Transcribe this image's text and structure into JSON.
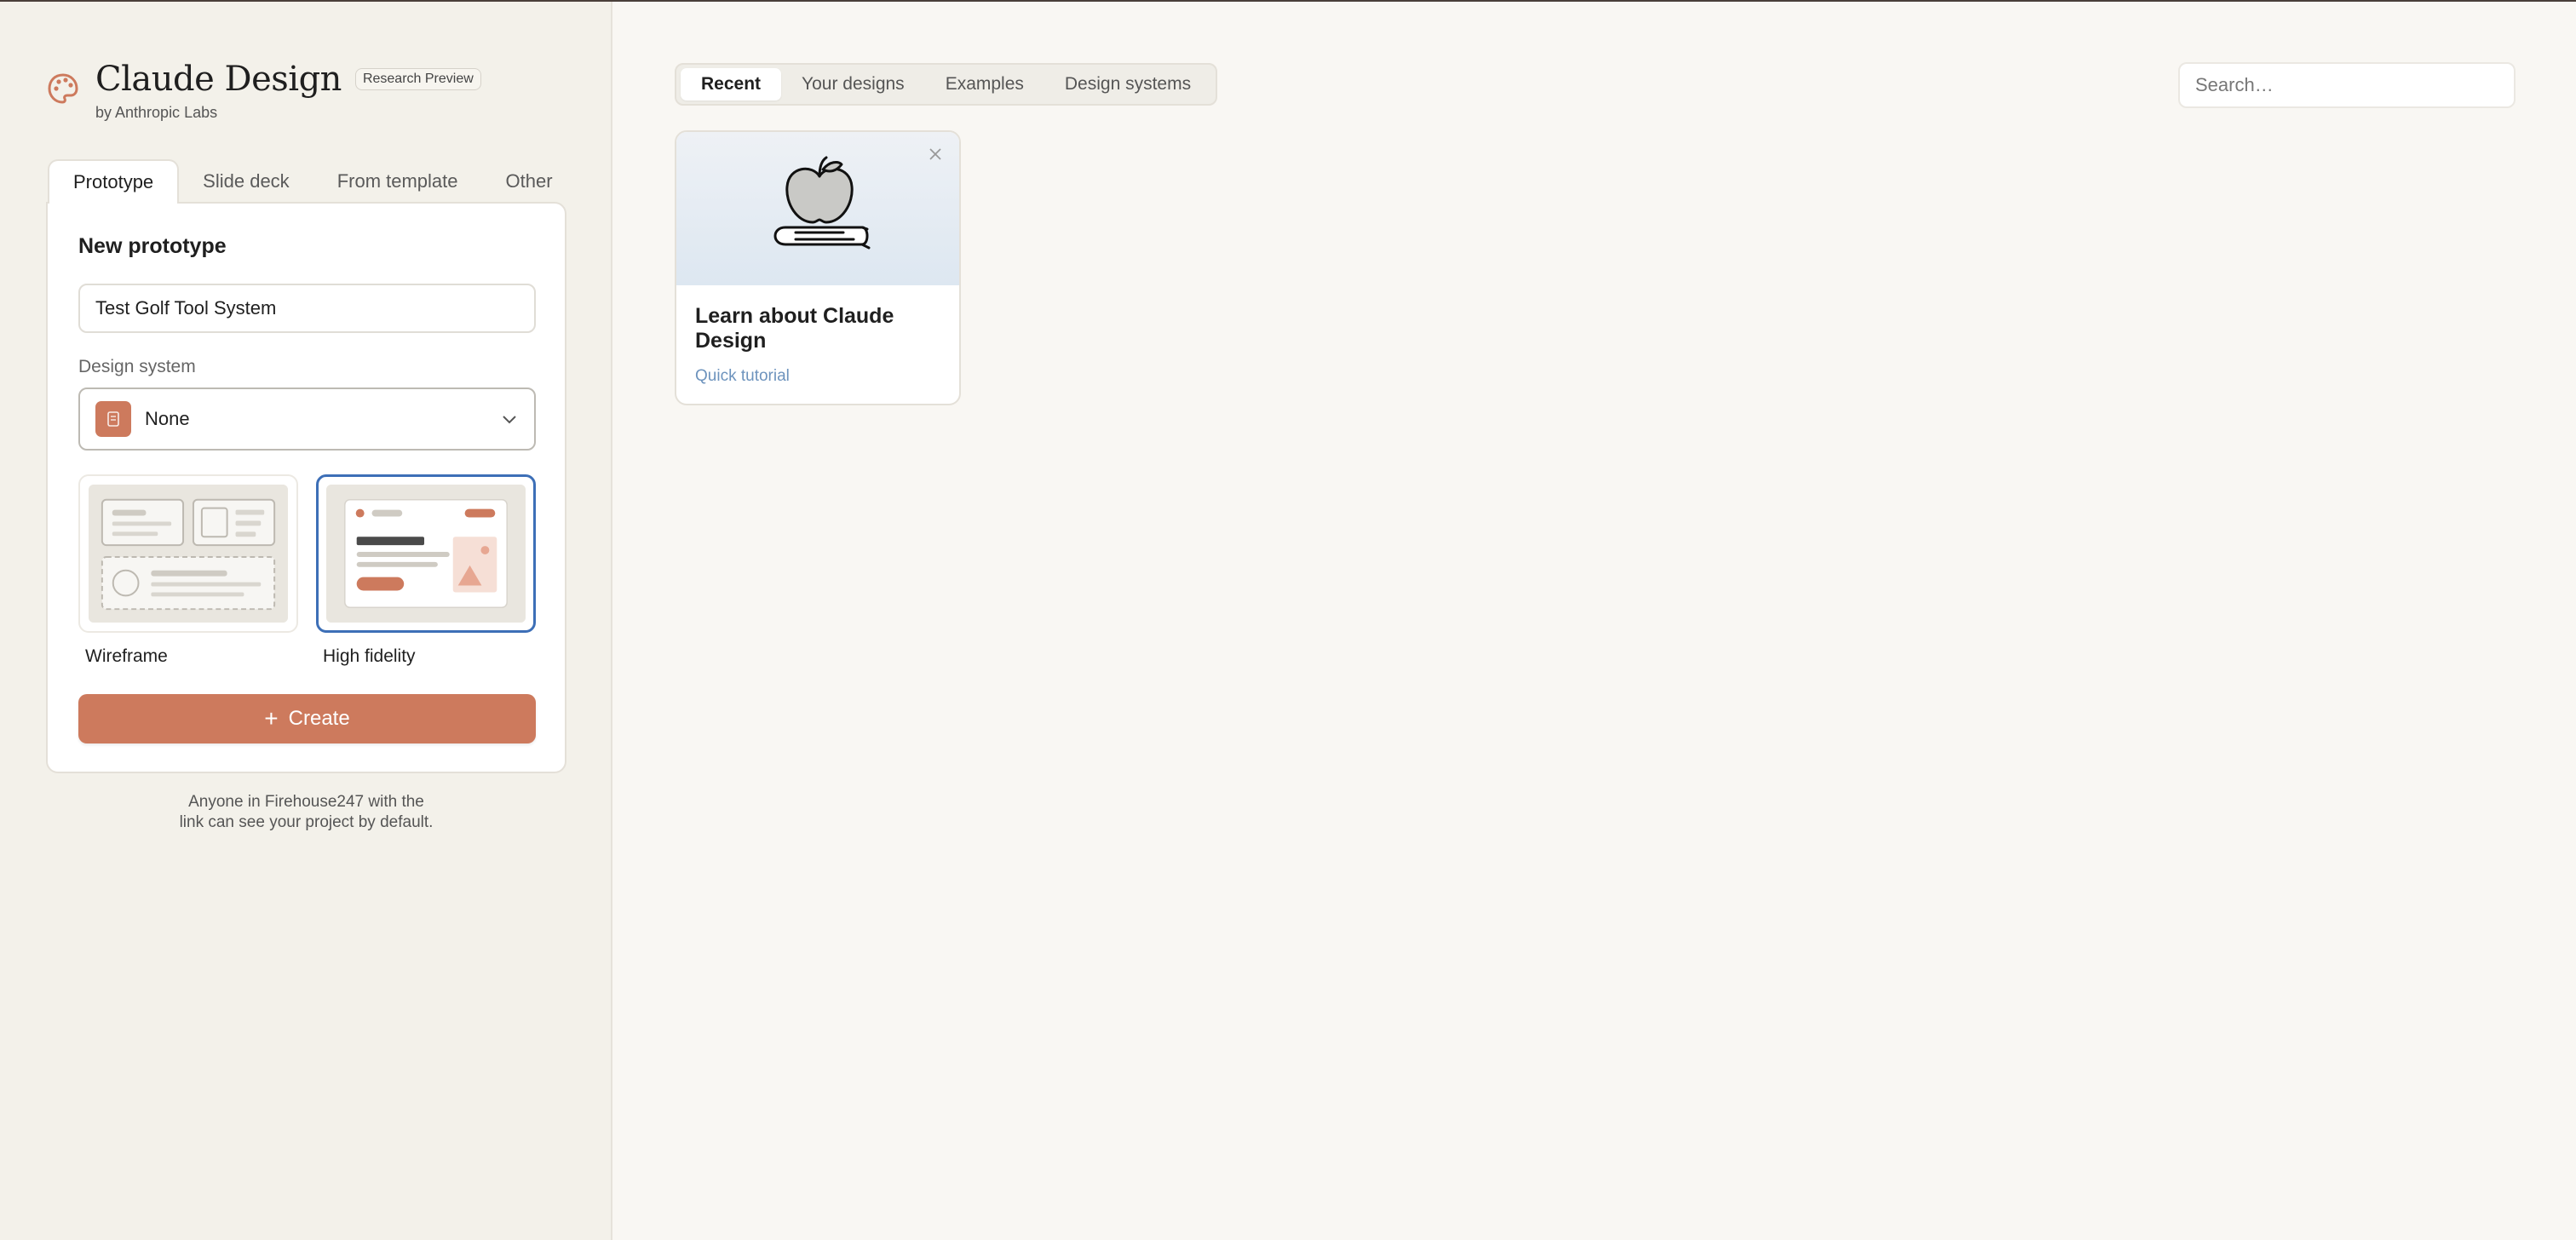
{
  "app": {
    "title": "Claude Design",
    "badge": "Research Preview",
    "subtitle": "by Anthropic Labs"
  },
  "sidebar": {
    "tabs": [
      {
        "label": "Prototype",
        "active": true
      },
      {
        "label": "Slide deck",
        "active": false
      },
      {
        "label": "From template",
        "active": false
      },
      {
        "label": "Other",
        "active": false
      }
    ],
    "panel": {
      "title": "New prototype",
      "name_value": "Test Golf Tool System",
      "design_system_label": "Design system",
      "design_system_value": "None",
      "options": [
        {
          "label": "Wireframe",
          "selected": false
        },
        {
          "label": "High fidelity",
          "selected": true
        }
      ],
      "create_label": "Create"
    },
    "footnote_line1": "Anyone in Firehouse247 with the",
    "footnote_line2": "link can see your project by default."
  },
  "main": {
    "tabs": [
      {
        "label": "Recent",
        "active": true
      },
      {
        "label": "Your designs",
        "active": false
      },
      {
        "label": "Examples",
        "active": false
      },
      {
        "label": "Design systems",
        "active": false
      }
    ],
    "search_placeholder": "Search…",
    "cards": [
      {
        "title": "Learn about Claude Design",
        "link": "Quick tutorial",
        "icon": "apple-on-book-icon"
      }
    ]
  },
  "colors": {
    "accent": "#cd7a5d",
    "selected_border": "#3d6fb7",
    "link": "#6d93bd",
    "background": "#f9f7f3",
    "sidebar_bg": "#f3f1ea"
  }
}
